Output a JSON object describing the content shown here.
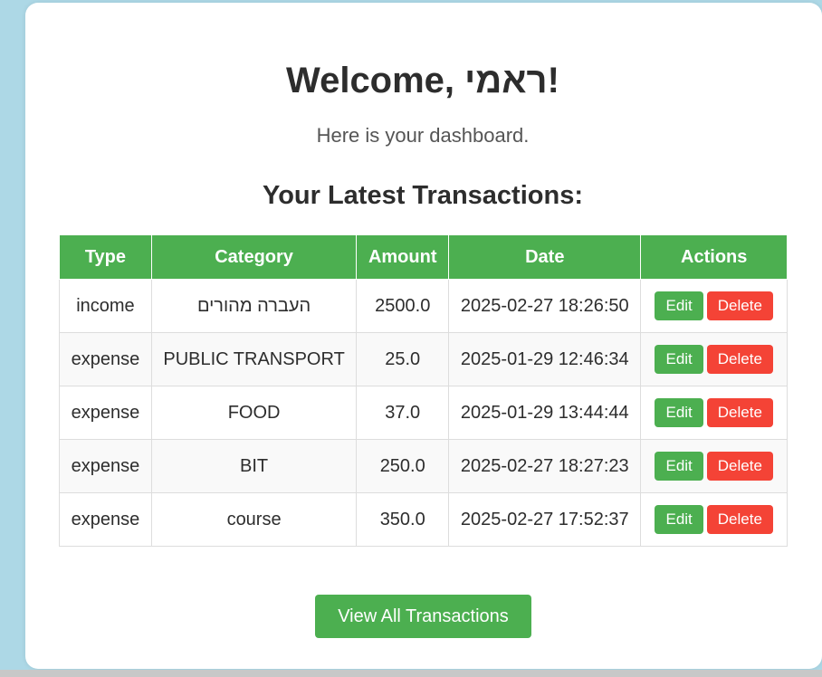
{
  "header": {
    "welcome": "Welcome, ראמי!",
    "subtitle": "Here is your dashboard."
  },
  "transactions": {
    "title": "Your Latest Transactions:",
    "columns": [
      "Type",
      "Category",
      "Amount",
      "Date",
      "Actions"
    ],
    "edit_label": "Edit",
    "delete_label": "Delete",
    "rows": [
      {
        "type": "income",
        "category": "העברה מהורים",
        "amount": "2500.0",
        "date": "2025-02-27 18:26:50"
      },
      {
        "type": "expense",
        "category": "PUBLIC TRANSPORT",
        "amount": "25.0",
        "date": "2025-01-29 12:46:34"
      },
      {
        "type": "expense",
        "category": "FOOD",
        "amount": "37.0",
        "date": "2025-01-29 13:44:44"
      },
      {
        "type": "expense",
        "category": "BIT",
        "amount": "250.0",
        "date": "2025-02-27 18:27:23"
      },
      {
        "type": "expense",
        "category": "course",
        "amount": "350.0",
        "date": "2025-02-27 17:52:37"
      }
    ]
  },
  "footer": {
    "view_all_label": "View All Transactions"
  },
  "colors": {
    "background": "#add8e6",
    "accent": "#4caf50",
    "danger": "#f44336"
  }
}
